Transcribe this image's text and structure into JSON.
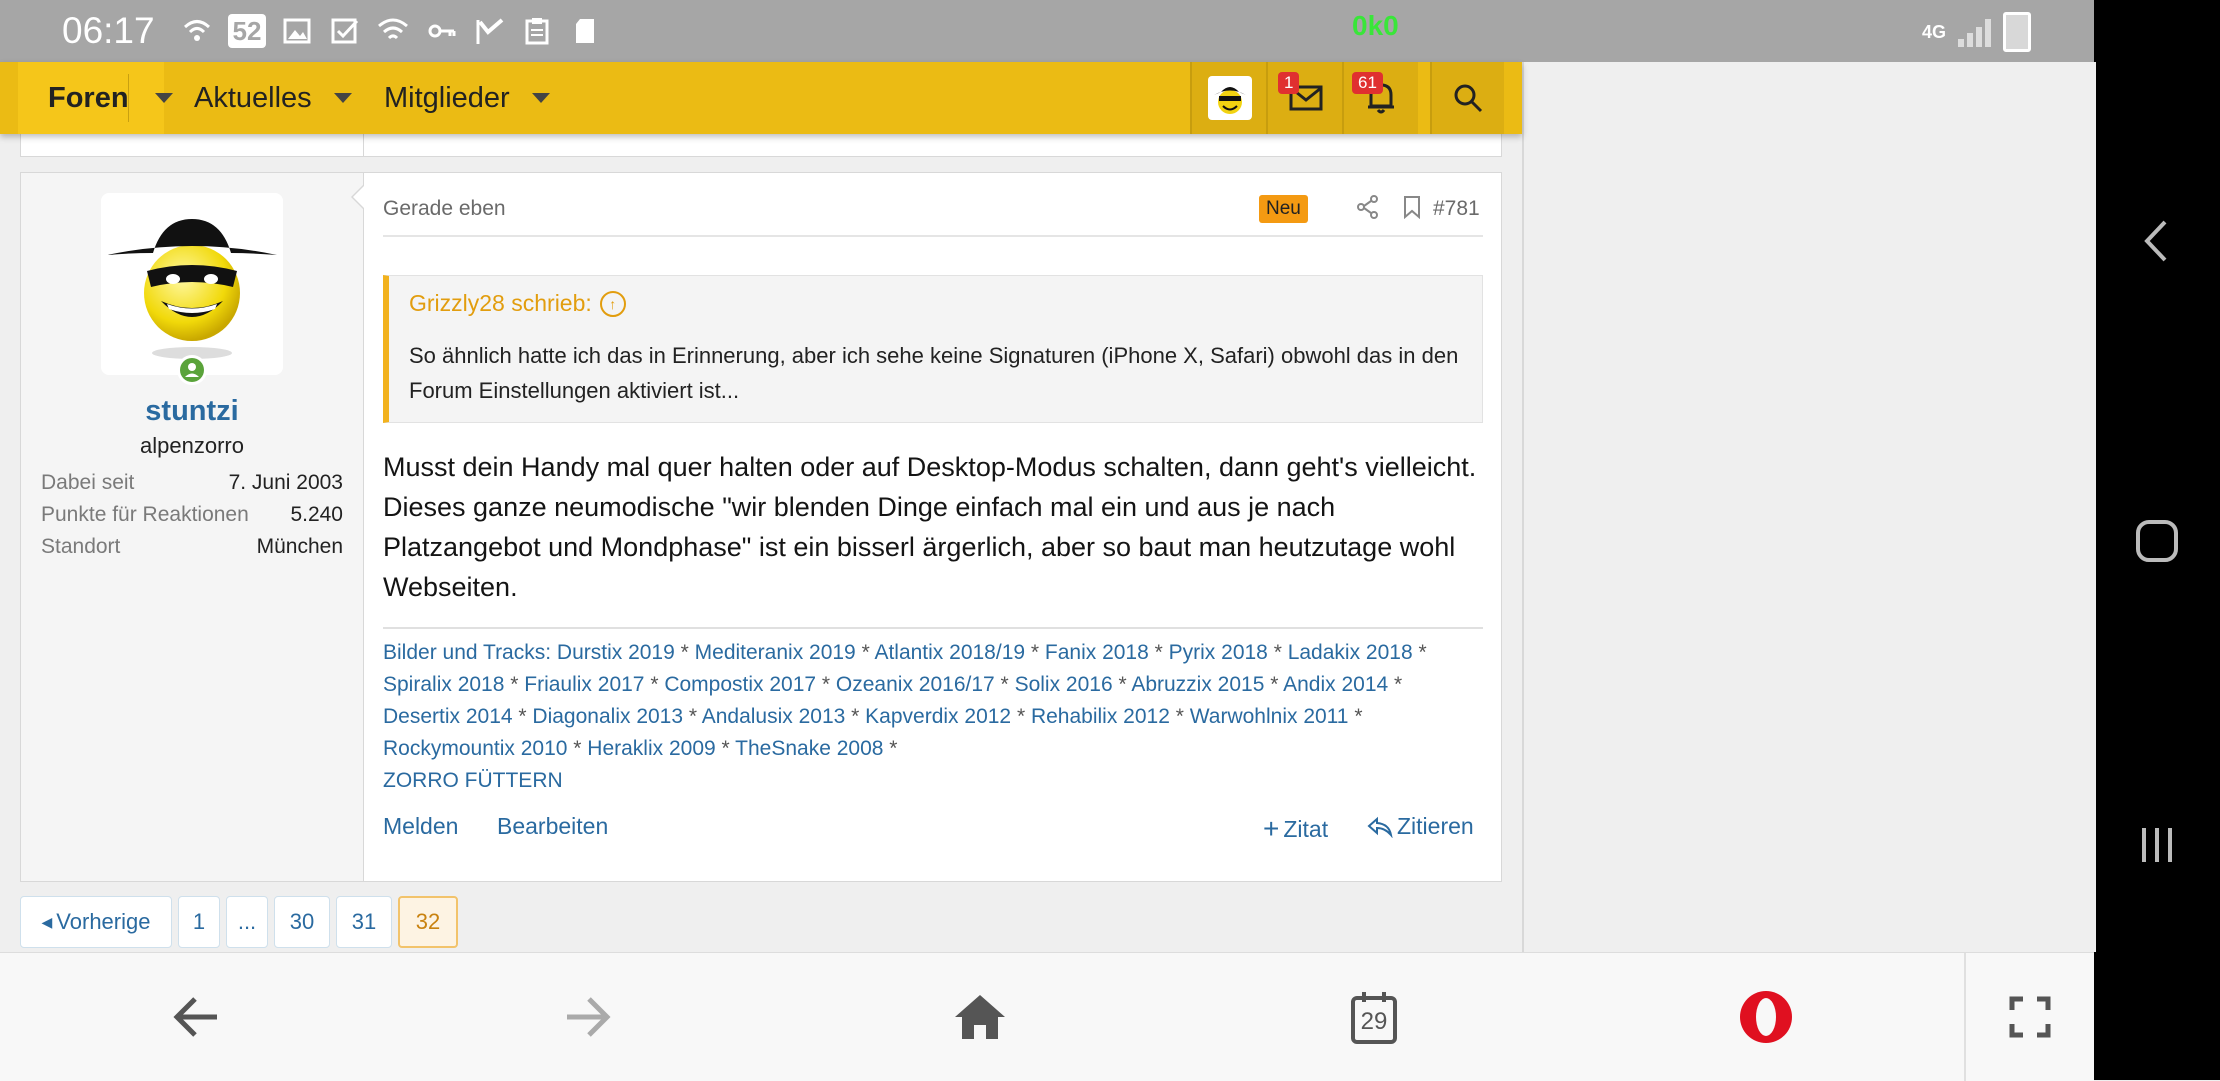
{
  "status_bar": {
    "time": "06:17",
    "notification_count": "52",
    "speed": "0k0",
    "network": "4G"
  },
  "nav": {
    "items": [
      {
        "label": "Foren"
      },
      {
        "label": "Aktuelles"
      },
      {
        "label": "Mitglieder"
      }
    ],
    "messages_badge": "1",
    "alerts_badge": "61"
  },
  "post": {
    "user": {
      "name": "stuntzi",
      "title": "alpenzorro",
      "stats": [
        {
          "key": "Dabei seit",
          "value": "7. Juni 2003"
        },
        {
          "key": "Punkte für Reaktionen",
          "value": "5.240"
        },
        {
          "key": "Standort",
          "value": "München"
        }
      ]
    },
    "date": "Gerade eben",
    "badge": "Neu",
    "number": "#781",
    "quote": {
      "author": "Grizzly28 schrieb:",
      "text": "So ähnlich hatte ich das in Erinnerung, aber ich sehe keine Signaturen (iPhone X, Safari) obwohl das in den Forum Einstellungen aktiviert ist..."
    },
    "body": "Musst dein Handy mal quer halten oder auf Desktop-Modus schalten, dann geht's vielleicht. Dieses ganze neumodische \"wir blenden Dinge einfach mal ein und aus je nach Platzangebot und Mondphase\" ist ein bisserl ärgerlich, aber so baut man heutzutage wohl Webseiten.",
    "signature": {
      "links": [
        "Bilder und Tracks: Durstix 2019",
        "Mediteranix 2019",
        "Atlantix 2018/19",
        "Fanix 2018",
        "Pyrix 2018",
        "Ladakix 2018",
        "Spiralix 2018",
        "Friaulix 2017",
        "Compostix 2017",
        "Ozeanix 2016/17",
        "Solix 2016",
        "Abruzzix 2015",
        "Andix 2014",
        "Desertix 2014",
        "Diagonalix 2013",
        "Andalusix 2013",
        "Kapverdix 2012",
        "Rehabilix 2012",
        "Warwohlnix 2011",
        "Rockymountix 2010",
        "Heraklix 2009",
        "TheSnake 2008"
      ],
      "separator": " * ",
      "footer": "ZORRO FÜTTERN"
    },
    "actions": {
      "report": "Melden",
      "edit": "Bearbeiten",
      "multiquote": "Zitat",
      "reply": "Zitieren"
    }
  },
  "pagination": {
    "prev": "Vorherige",
    "pages": [
      "1",
      "...",
      "30",
      "31",
      "32"
    ],
    "current": "32"
  },
  "browser": {
    "tabs_count": "29"
  },
  "colors": {
    "nav_yellow": "#ebbb14",
    "link_blue": "#2a6aa0",
    "quote_orange": "#e29d0e",
    "badge_red": "#e03030"
  }
}
